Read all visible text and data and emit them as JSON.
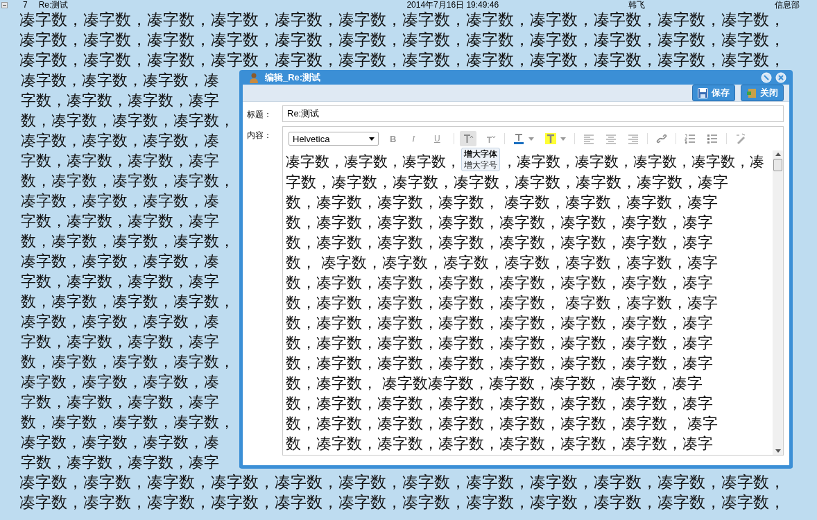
{
  "top_bar": {
    "number": "7",
    "subject": "Re:测试",
    "datetime": "2014年7月16日 19:49:46",
    "user": "韩飞",
    "department": "信息部"
  },
  "background_text": {
    "top_lines": [
      "凑字数，凑字数，凑字数，凑字数，凑字数，凑字数，凑字数，凑字数，凑字数，凑字数，凑字数，凑字数，",
      "凑字数，凑字数，凑字数，凑字数，凑字数，凑字数，凑字数，凑字数，凑字数，凑字数，凑字数，凑字数，",
      "凑字数，凑字数，凑字数，凑字数，凑字数，凑字数，凑字数，凑字数，凑字数，凑字数，凑字数，凑字数，"
    ],
    "left_lines": [
      "凑字数，凑字数，凑字数，凑",
      "字数，凑字数，凑字数，凑字",
      "数，凑字数，凑字数，凑字数，",
      "凑字数，凑字数，凑字数，凑",
      "字数，凑字数，凑字数，凑字",
      "数，凑字数，凑字数，凑字数，",
      "凑字数，凑字数，凑字数，凑",
      "字数，凑字数，凑字数，凑字",
      "数，凑字数，凑字数，凑字数，",
      "凑字数，凑字数，凑字数，凑",
      "字数，凑字数，凑字数，凑字",
      "数，凑字数，凑字数，凑字数，",
      "凑字数，凑字数，凑字数，凑",
      "字数，凑字数，凑字数，凑字",
      "数，凑字数，凑字数，凑字数，",
      "凑字数，凑字数，凑字数，凑",
      "字数，凑字数，凑字数，凑字",
      "数，凑字数，凑字数，凑字数，",
      "凑字数，凑字数，凑字数，凑",
      "字数，凑字数，凑字数，凑字"
    ],
    "bottom_lines": [
      "凑字数，凑字数，凑字数，凑字数，凑字数，凑字数，凑字数，凑字数，凑字数，凑字数，凑字数，凑字数，",
      "凑字数，凑字数，凑字数，凑字数，凑字数，凑字数，凑字数，凑字数，凑字数，凑字数，凑字数，凑字数，"
    ]
  },
  "dialog": {
    "title": "编辑_Re:测试",
    "actions": [
      {
        "kind": "save",
        "label": "保存"
      },
      {
        "kind": "close",
        "label": "关闭"
      }
    ],
    "title_label": "标题：",
    "title_value": "Re:测试",
    "content_label": "内容：",
    "editor": {
      "font": "Helvetica",
      "tools": [
        {
          "kind": "bold",
          "glyph": "B",
          "hovered": false
        },
        {
          "kind": "italic",
          "glyph": "I",
          "hovered": false
        },
        {
          "kind": "underline",
          "glyph": "U",
          "hovered": false
        },
        {
          "kind": "separator"
        },
        {
          "kind": "grow-font",
          "hovered": true
        },
        {
          "kind": "shrink-font",
          "hovered": false
        },
        {
          "kind": "separator"
        },
        {
          "kind": "text-color",
          "hovered": false
        },
        {
          "kind": "highlight",
          "hovered": false
        },
        {
          "kind": "separator"
        },
        {
          "kind": "align-left",
          "hovered": false
        },
        {
          "kind": "align-center",
          "hovered": false
        },
        {
          "kind": "align-right",
          "hovered": false
        },
        {
          "kind": "separator"
        },
        {
          "kind": "link",
          "hovered": false
        },
        {
          "kind": "separator"
        },
        {
          "kind": "ordered-list",
          "hovered": false
        },
        {
          "kind": "unordered-list",
          "hovered": false
        },
        {
          "kind": "separator"
        },
        {
          "kind": "clear-format",
          "hovered": false
        }
      ],
      "tooltip": {
        "title": "增大字体",
        "subtitle": "增大字号"
      },
      "lines": [
        [
          "凑字数，凑字数，凑字数，",
          "，凑字数，凑字数，凑字数，凑字数，凑"
        ],
        "字数，凑字数，凑字数，凑字数，凑字数，凑字数，凑字数，凑字",
        "数，凑字数，凑字数，凑字数， 凑字数，凑字数，凑字数，凑字",
        "数，凑字数，凑字数，凑字数，凑字数，凑字数，凑字数，凑字",
        "数，凑字数，凑字数，凑字数，凑字数，凑字数，凑字数，凑字",
        "数， 凑字数，凑字数，凑字数，凑字数，凑字数，凑字数，凑字",
        "数，凑字数，凑字数，凑字数，凑字数，凑字数，凑字数，凑字",
        "数，凑字数，凑字数，凑字数，凑字数， 凑字数，凑字数，凑字",
        "数，凑字数，凑字数，凑字数，凑字数，凑字数，凑字数，凑字",
        "数，凑字数，凑字数，凑字数，凑字数，凑字数，凑字数，凑字",
        "数，凑字数，凑字数，凑字数，凑字数，凑字数，凑字数，凑字",
        "数，凑字数， 凑字数凑字数，凑字数，凑字数，凑字数，凑字",
        "数，凑字数，凑字数，凑字数，凑字数，凑字数，凑字数，凑字",
        "数，凑字数，凑字数，凑字数，凑字数，凑字数，凑字数， 凑字",
        "数，凑字数，凑字数，凑字数，凑字数，凑字数，凑字数，凑字"
      ]
    }
  }
}
